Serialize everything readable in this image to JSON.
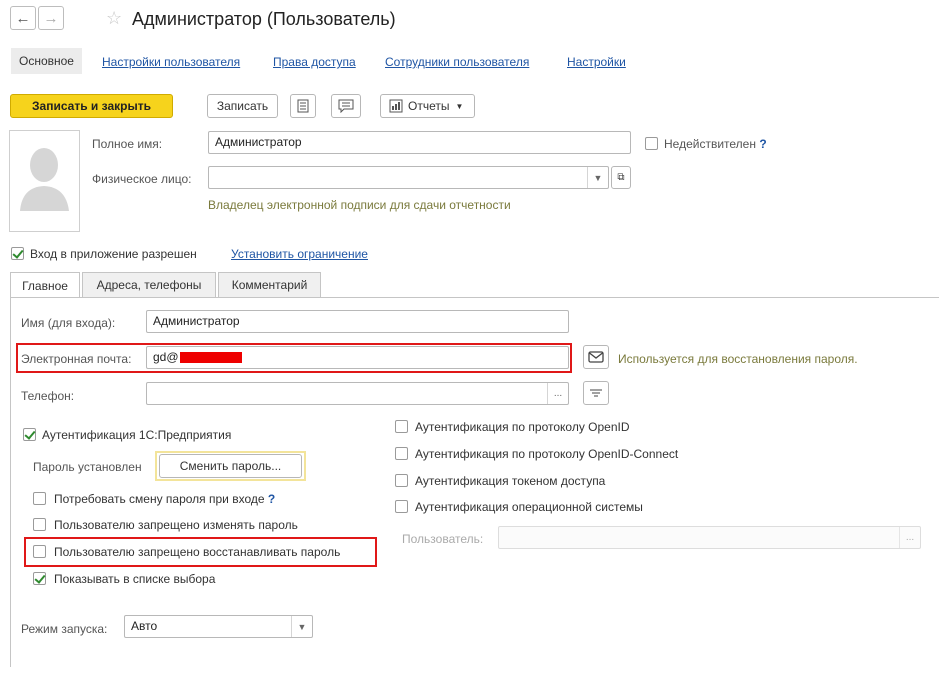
{
  "window": {
    "title": "Администратор (Пользователь)"
  },
  "nav": {
    "back_icon": "←",
    "forward_icon": "→"
  },
  "section_tabs": [
    {
      "label": "Основное"
    },
    {
      "label": "Настройки пользователя"
    },
    {
      "label": "Права доступа"
    },
    {
      "label": "Сотрудники пользователя"
    },
    {
      "label": "Настройки"
    }
  ],
  "toolbar": {
    "save_close_label": "Записать и закрыть",
    "save_label": "Записать",
    "reports_label": "Отчеты"
  },
  "header_form": {
    "full_name_label": "Полное имя:",
    "full_name_value": "Администратор",
    "invalid_label": "Недействителен",
    "help_mark": "?",
    "individual_label": "Физическое лицо:",
    "individual_value": "",
    "signature_note": "Владелец электронной подписи для сдачи отчетности"
  },
  "login_allowed": {
    "label": "Вход в приложение разрешен",
    "checked": true,
    "restrict_link": "Установить ограничение"
  },
  "tabs": [
    {
      "label": "Главное"
    },
    {
      "label": "Адреса, телефоны"
    },
    {
      "label": "Комментарий"
    }
  ],
  "main_tab": {
    "login_label": "Имя (для входа):",
    "login_value": "Администратор",
    "email_label": "Электронная почта:",
    "email_value": "gd@",
    "email_note": "Используется для восстановления пароля.",
    "phone_label": "Телефон:",
    "phone_value": "",
    "phone_ellipsis": "...",
    "auth_1c_label": "Аутентификация 1С:Предприятия",
    "password_set_label": "Пароль установлен",
    "change_password_label": "Сменить пароль...",
    "require_change_label": "Потребовать смену пароля при входе",
    "forbid_change_label": "Пользователю запрещено изменять пароль",
    "forbid_restore_label": "Пользователю запрещено восстанавливать пароль",
    "show_in_list_label": "Показывать в списке выбора",
    "openid_label": "Аутентификация по протоколу OpenID",
    "openid_connect_label": "Аутентификация по протоколу OpenID-Connect",
    "token_label": "Аутентификация токеном доступа",
    "os_auth_label": "Аутентификация операционной системы",
    "os_user_label": "Пользователь:",
    "os_user_ellipsis": "...",
    "launch_mode_label": "Режим запуска:",
    "launch_mode_value": "Авто"
  },
  "checkbox_states": {
    "invalid": false,
    "auth_1c": true,
    "require_change": false,
    "forbid_change": false,
    "forbid_restore": false,
    "show_in_list": true,
    "openid": false,
    "openid_connect": false,
    "token": false,
    "os_auth": false
  },
  "colors": {
    "accent_yellow": "#f6d31c",
    "link_blue": "#1f55a4",
    "highlight_red": "#e01818",
    "redaction_red": "#ee0000"
  }
}
